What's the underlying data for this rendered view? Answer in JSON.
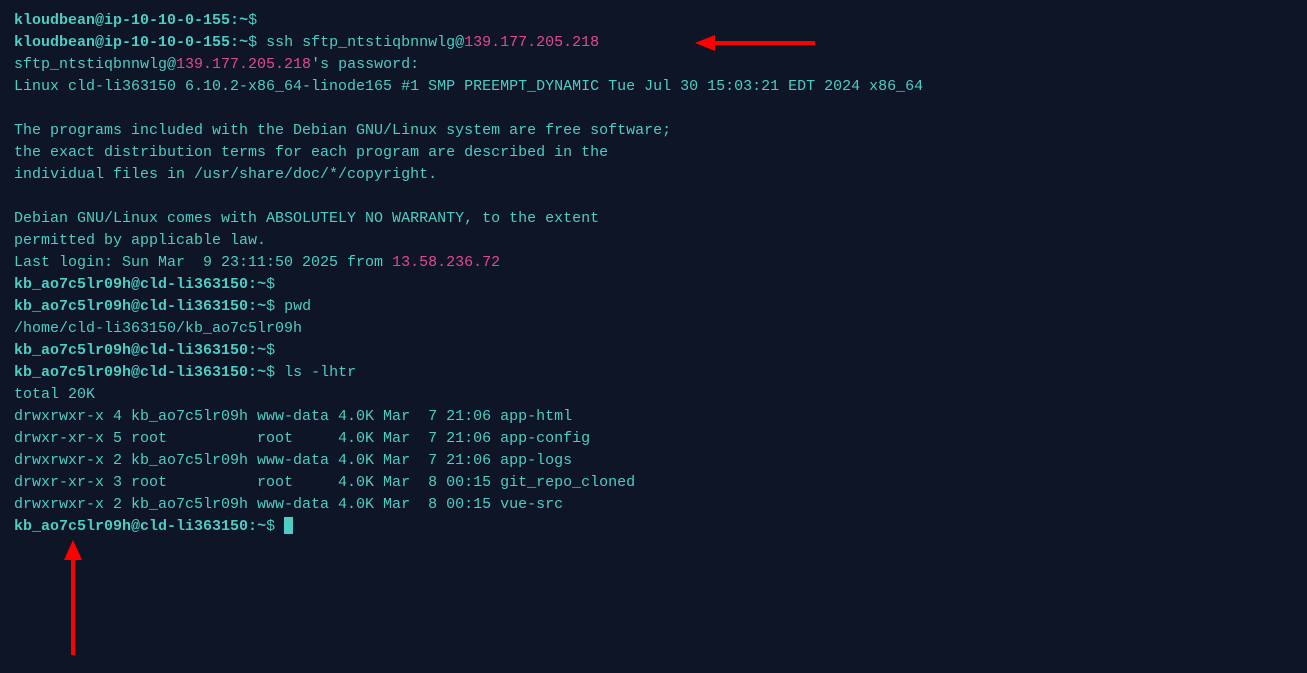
{
  "terminal": {
    "lines": [
      {
        "type": "prompt_local",
        "user": "kloudbean@ip-10-10-0-155",
        "path": "~",
        "cmd": ""
      },
      {
        "type": "prompt_local",
        "user": "kloudbean@ip-10-10-0-155",
        "path": "~",
        "cmd": "ssh sftp_ntstiqbnnwlg@",
        "ip": "139.177.205.218"
      },
      {
        "type": "pwdprompt",
        "prefix": "sftp_ntstiqbnnwlg@",
        "ip": "139.177.205.218",
        "suffix": "'s password:"
      },
      {
        "type": "output",
        "text": "Linux cld-li363150 6.10.2-x86_64-linode165 #1 SMP PREEMPT_DYNAMIC Tue Jul 30 15:03:21 EDT 2024 x86_64"
      },
      {
        "type": "blank"
      },
      {
        "type": "output",
        "text": "The programs included with the Debian GNU/Linux system are free software;"
      },
      {
        "type": "output",
        "text": "the exact distribution terms for each program are described in the"
      },
      {
        "type": "output",
        "text": "individual files in /usr/share/doc/*/copyright."
      },
      {
        "type": "blank"
      },
      {
        "type": "output",
        "text": "Debian GNU/Linux comes with ABSOLUTELY NO WARRANTY, to the extent"
      },
      {
        "type": "output",
        "text": "permitted by applicable law."
      },
      {
        "type": "lastlogin",
        "prefix": "Last login: Sun Mar  9 23:11:50 2025 from ",
        "ip": "13.58.236.72"
      },
      {
        "type": "prompt_remote",
        "user": "kb_ao7c5lr09h@cld-li363150",
        "path": "~",
        "cmd": ""
      },
      {
        "type": "prompt_remote",
        "user": "kb_ao7c5lr09h@cld-li363150",
        "path": "~",
        "cmd": "pwd"
      },
      {
        "type": "output",
        "text": "/home/cld-li363150/kb_ao7c5lr09h"
      },
      {
        "type": "prompt_remote",
        "user": "kb_ao7c5lr09h@cld-li363150",
        "path": "~",
        "cmd": ""
      },
      {
        "type": "prompt_remote",
        "user": "kb_ao7c5lr09h@cld-li363150",
        "path": "~",
        "cmd": "ls -lhtr"
      },
      {
        "type": "output",
        "text": "total 20K"
      },
      {
        "type": "output",
        "text": "drwxrwxr-x 4 kb_ao7c5lr09h www-data 4.0K Mar  7 21:06 app-html"
      },
      {
        "type": "output",
        "text": "drwxr-xr-x 5 root          root     4.0K Mar  7 21:06 app-config"
      },
      {
        "type": "output",
        "text": "drwxrwxr-x 2 kb_ao7c5lr09h www-data 4.0K Mar  7 21:06 app-logs"
      },
      {
        "type": "output",
        "text": "drwxr-xr-x 3 root          root     4.0K Mar  8 00:15 git_repo_cloned"
      },
      {
        "type": "output",
        "text": "drwxrwxr-x 2 kb_ao7c5lr09h www-data 4.0K Mar  8 00:15 vue-src"
      },
      {
        "type": "prompt_cursor",
        "user": "kb_ao7c5lr09h@cld-li363150",
        "path": "~"
      }
    ]
  },
  "annotations": {
    "arrow_right_color": "#ff0000",
    "arrow_up_color": "#ff0000"
  }
}
